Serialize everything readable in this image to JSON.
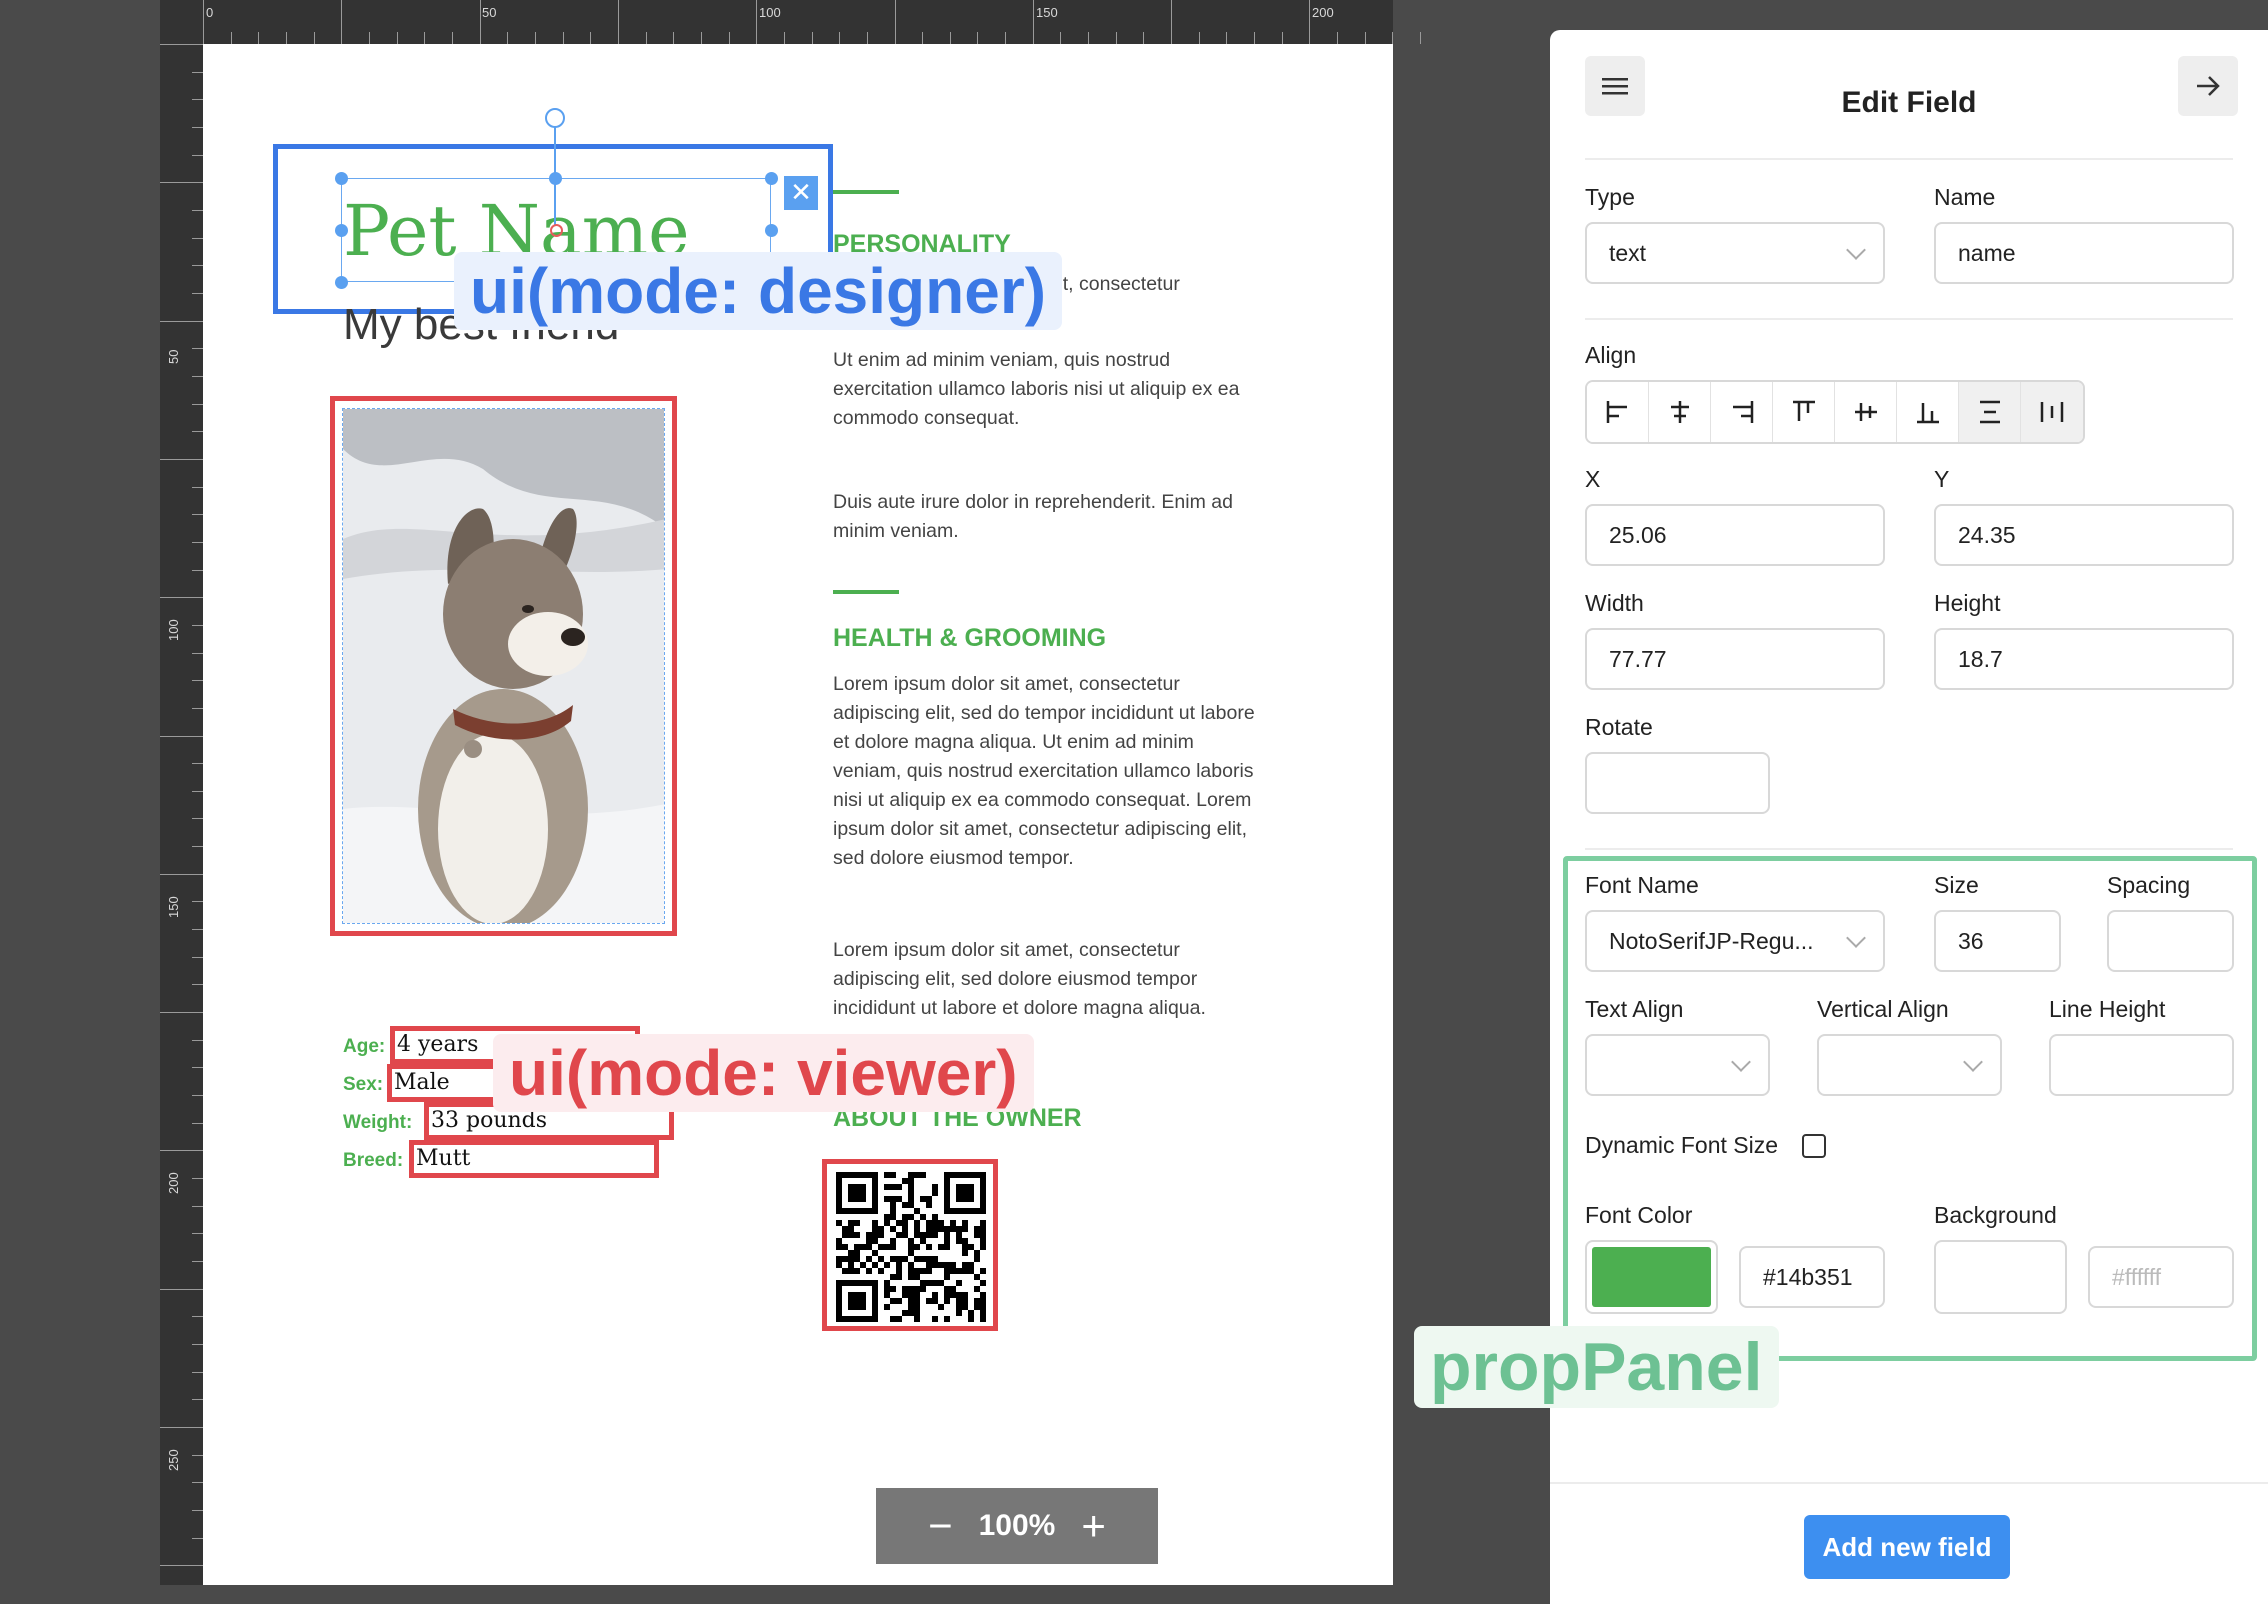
{
  "ruler": {
    "top_labels": [
      "0",
      "50",
      "100",
      "150",
      "200"
    ],
    "left_labels": [
      "50",
      "100",
      "150",
      "200",
      "250"
    ]
  },
  "canvas": {
    "pet_name": "Pet Name",
    "subtitle": "My best friend",
    "sections": [
      {
        "heading": "PERSONALITY",
        "paragraphs": [
          "Lorem ipsum dolor sit amet, consectetur",
          "Ut enim ad minim veniam, quis nostrud exercitation ullamco laboris nisi ut aliquip ex ea commodo consequat.",
          "Duis aute irure dolor in reprehenderit. Enim ad minim veniam."
        ]
      },
      {
        "heading": "HEALTH & GROOMING",
        "paragraphs": [
          "Lorem ipsum dolor sit amet, consectetur adipiscing elit, sed do tempor incididunt ut labore et dolore magna aliqua. Ut enim ad minim veniam, quis nostrud exercitation ullamco laboris nisi ut aliquip ex ea commodo consequat. Lorem ipsum dolor sit amet, consectetur adipiscing elit, sed dolore eiusmod tempor.",
          "Lorem ipsum dolor sit amet, consectetur adipiscing elit, sed dolore eiusmod tempor incididunt ut labore et dolore magna aliqua."
        ]
      },
      {
        "heading": "ABOUT THE OWNER"
      }
    ],
    "info": [
      {
        "label": "Age:",
        "value": "4 years"
      },
      {
        "label": "Sex:",
        "value": "Male"
      },
      {
        "label": "Weight:",
        "value": "33 pounds"
      },
      {
        "label": "Breed:",
        "value": "Mutt"
      }
    ],
    "close_symbol": "✕",
    "zoom": {
      "minus": "−",
      "value": "100%",
      "plus": "+"
    }
  },
  "annotations": {
    "designer": "ui(mode: designer)",
    "viewer": "ui(mode: viewer)",
    "prop_panel": "propPanel"
  },
  "panel": {
    "title": "Edit Field",
    "type": {
      "label": "Type",
      "value": "text"
    },
    "name": {
      "label": "Name",
      "value": "name"
    },
    "align_label": "Align",
    "x": {
      "label": "X",
      "value": "25.06"
    },
    "y": {
      "label": "Y",
      "value": "24.35"
    },
    "width": {
      "label": "Width",
      "value": "77.77"
    },
    "height": {
      "label": "Height",
      "value": "18.7"
    },
    "rotate": {
      "label": "Rotate",
      "value": ""
    },
    "font_name": {
      "label": "Font Name",
      "value": "NotoSerifJP-Regu..."
    },
    "size": {
      "label": "Size",
      "value": "36"
    },
    "spacing": {
      "label": "Spacing",
      "value": ""
    },
    "text_align": {
      "label": "Text Align",
      "value": ""
    },
    "vertical_align": {
      "label": "Vertical Align",
      "value": ""
    },
    "line_height": {
      "label": "Line Height",
      "value": ""
    },
    "dynamic_font_size": {
      "label": "Dynamic Font Size",
      "checked": false
    },
    "font_color": {
      "label": "Font Color",
      "value": "#14b351",
      "swatch": "#4caf50"
    },
    "background": {
      "label": "Background",
      "placeholder": "#ffffff",
      "swatch": "#ffffff"
    },
    "add_button": "Add new field"
  },
  "colors": {
    "designer": "#3a78e5",
    "viewer": "#e0474c",
    "prop_panel": "#7dcea0",
    "accent_green": "#4caf50",
    "button_blue": "#3d8ff0"
  }
}
